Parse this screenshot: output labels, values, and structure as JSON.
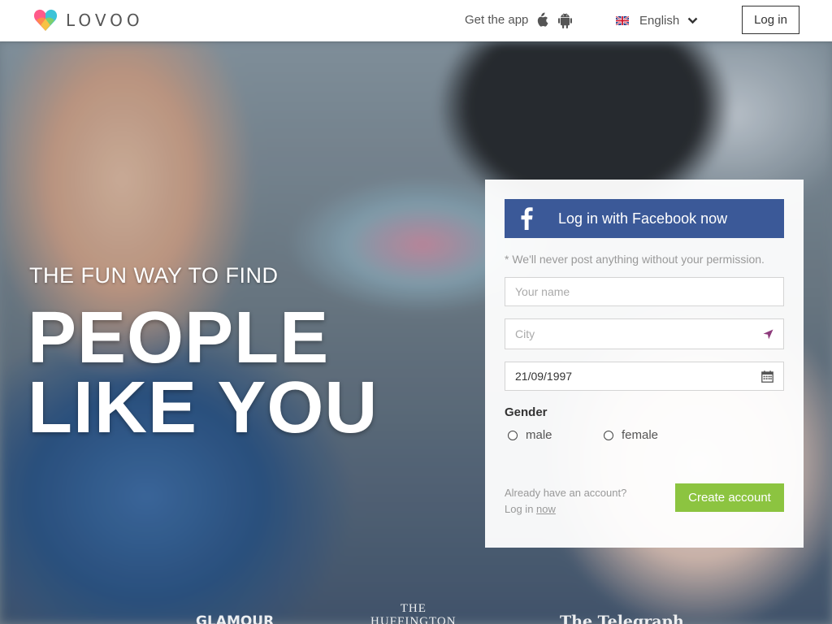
{
  "header": {
    "brand": "LOVOO",
    "get_app": "Get the app",
    "language": "English",
    "login": "Log in"
  },
  "hero": {
    "tagline": "THE FUN WAY TO FIND",
    "headline_line1": "PEOPLE",
    "headline_line2": "LIKE YOU"
  },
  "signup": {
    "facebook_button": "Log in with Facebook now",
    "note": "* We'll never post anything without your permission.",
    "name_placeholder": "Your name",
    "city_placeholder": "City",
    "birthdate_value": "21/09/1997",
    "gender_label": "Gender",
    "gender_options": [
      "male",
      "female"
    ],
    "already_account": "Already have an account?",
    "login_prefix": "Log in",
    "login_link": "now",
    "create_button": "Create account"
  },
  "press": [
    "GLAMOUR",
    "THE HUFFINGTON",
    "The Telegraph"
  ],
  "colors": {
    "facebook_blue": "#3b5998",
    "create_green": "#8cc440",
    "city_arrow_purple": "#8e3b7c"
  },
  "icons": [
    "heart-logo-icon",
    "apple-icon",
    "android-icon",
    "uk-flag-icon",
    "chevron-down-icon",
    "facebook-icon",
    "location-arrow-icon",
    "calendar-icon"
  ]
}
